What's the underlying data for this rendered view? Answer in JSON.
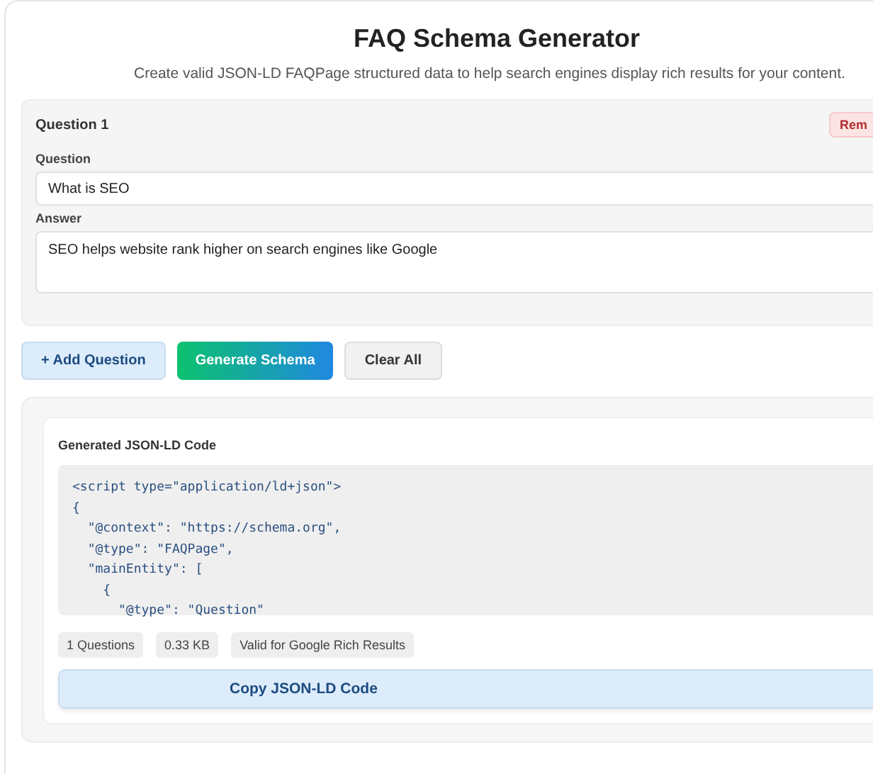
{
  "title": "FAQ Schema Generator",
  "subtitle": "Create valid JSON-LD FAQPage structured data to help search engines display rich results for your content.",
  "questions": [
    {
      "heading": "Question 1",
      "remove_label": "Rem",
      "question_label": "Question",
      "question_value": "What is SEO",
      "answer_label": "Answer",
      "answer_value": "SEO helps website rank higher on search engines like Google"
    }
  ],
  "actions": [
    {
      "label": "+ Add Question",
      "kind": "add"
    },
    {
      "label": "Generate Schema",
      "kind": "primary"
    },
    {
      "label": "Clear All",
      "kind": "plain"
    }
  ],
  "output": {
    "heading": "Generated JSON-LD Code",
    "code_lines": [
      "<script type=\"application/ld+json\">",
      "{",
      "  \"@context\": \"https://schema.org\",",
      "  \"@type\": \"FAQPage\",",
      "  \"mainEntity\": [",
      "    {",
      "      \"@type\": \"Question\""
    ],
    "stats": [
      "1 Questions",
      "0.33 KB",
      "Valid for Google Rich Results"
    ],
    "copy_label": "Copy JSON-LD Code"
  }
}
